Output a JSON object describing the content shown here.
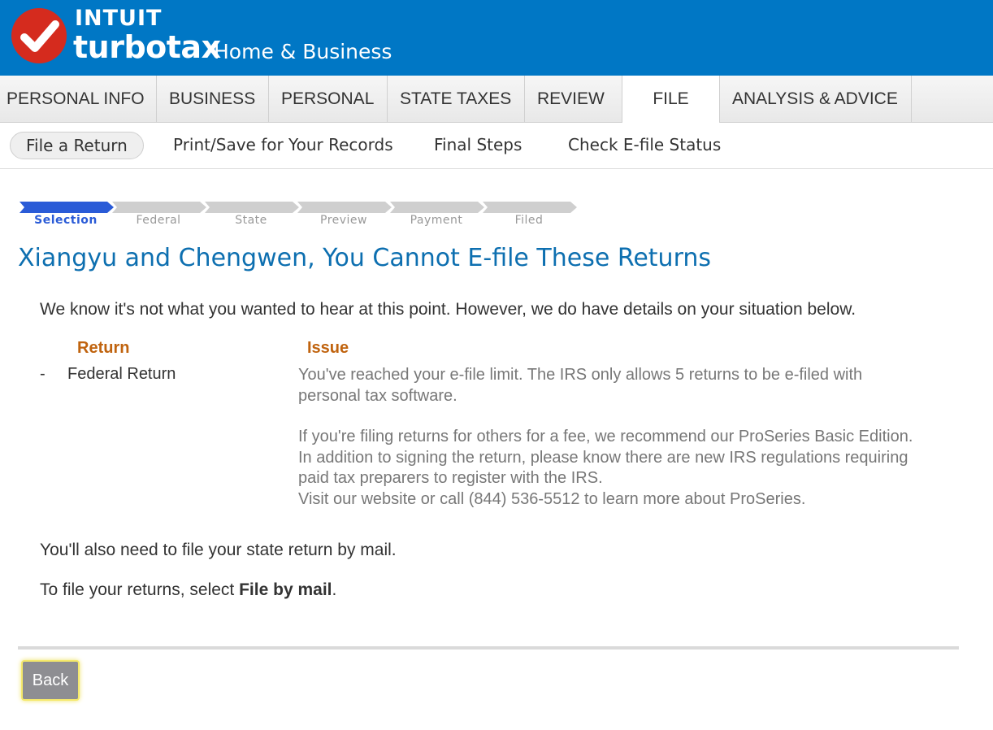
{
  "header": {
    "brand_top": "INTUIT",
    "brand_product": "turbotax",
    "brand_edition": "Home & Business",
    "logo_icon": "checkmark-icon",
    "colors": {
      "header_bg": "#0077c5",
      "logo_red": "#d52b1e"
    }
  },
  "main_nav": {
    "tabs": [
      {
        "label": "PERSONAL INFO"
      },
      {
        "label": "BUSINESS"
      },
      {
        "label": "PERSONAL"
      },
      {
        "label": "STATE TAXES"
      },
      {
        "label": "REVIEW"
      },
      {
        "label": "FILE",
        "active": true
      },
      {
        "label": "ANALYSIS & ADVICE"
      }
    ]
  },
  "sub_nav": {
    "items": [
      {
        "label": "File a Return",
        "active": true
      },
      {
        "label": "Print/Save for Your Records"
      },
      {
        "label": "Final Steps"
      },
      {
        "label": "Check E-file Status"
      }
    ]
  },
  "progress": {
    "steps": [
      "Selection",
      "Federal",
      "State",
      "Preview",
      "Payment",
      "Filed"
    ],
    "current": "Selection"
  },
  "content": {
    "title": "Xiangyu and Chengwen, You Cannot E-file These Returns",
    "intro": "We know it's not what you wanted to hear at this point. However, we do have details on your situation below.",
    "table": {
      "col_return": "Return",
      "col_issue": "Issue",
      "rows": [
        {
          "bullet": "-",
          "return": "Federal Return",
          "issue_lines_1": [
            "You've reached your e-file limit. The IRS only allows 5 returns to be e-filed with",
            "personal tax software."
          ],
          "issue_lines_2": [
            "If you're filing returns for others for a fee, we recommend our ProSeries Basic Edition.",
            "In addition to signing the return, please know there are new IRS regulations requiring",
            "paid tax preparers to register with the IRS.",
            "Visit our website or call (844) 536-5512 to learn more about ProSeries."
          ]
        }
      ]
    },
    "state_note": "You'll also need to file your state return by mail.",
    "file_note_prefix": "To file your returns, select ",
    "file_note_bold": "File by mail",
    "file_note_suffix": "."
  },
  "footer": {
    "back_label": "Back"
  }
}
